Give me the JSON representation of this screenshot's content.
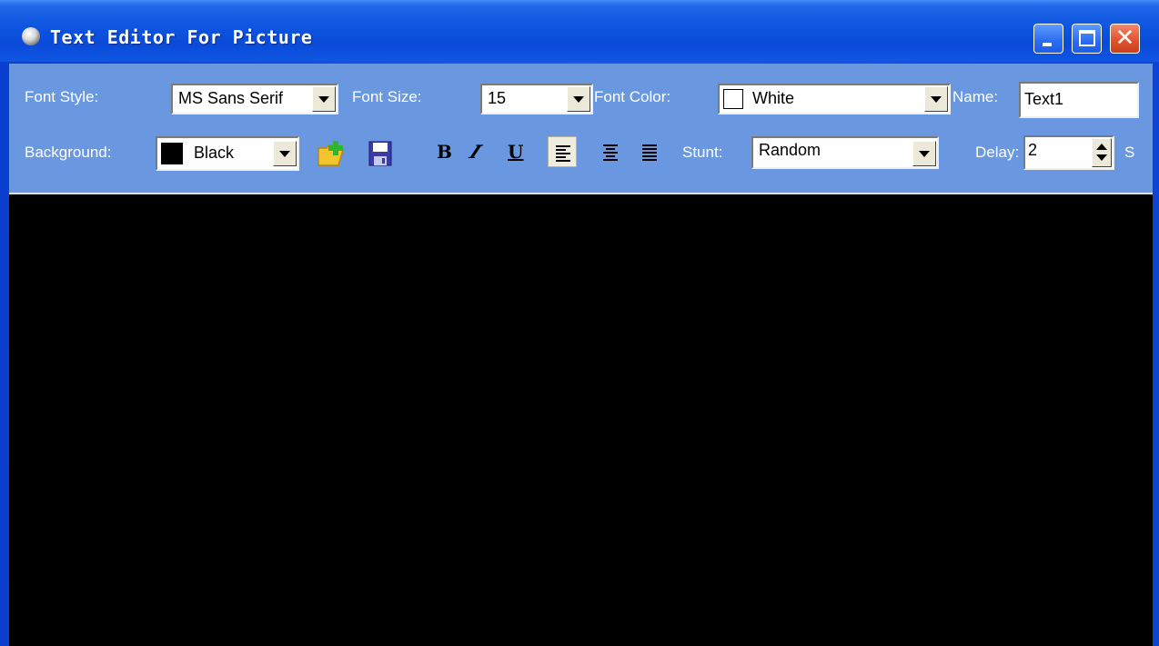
{
  "window": {
    "title": "Text Editor For Picture"
  },
  "toolbar": {
    "font_style": {
      "label": "Font Style:",
      "value": "MS Sans Serif"
    },
    "font_size": {
      "label": "Font Size:",
      "value": "15"
    },
    "font_color": {
      "label": "Font Color:",
      "value": "White",
      "swatch": "#ffffff"
    },
    "name": {
      "label": "Name:",
      "value": "Text1"
    },
    "background": {
      "label": "Background:",
      "value": "Black",
      "swatch": "#000000"
    },
    "bold_label": "B",
    "italic_label": "I",
    "underline_label": "U",
    "stunt": {
      "label": "Stunt:",
      "value": "Random"
    },
    "delay": {
      "label": "Delay:",
      "value": "2",
      "unit": "S"
    }
  },
  "canvas": {
    "background": "#000000"
  }
}
